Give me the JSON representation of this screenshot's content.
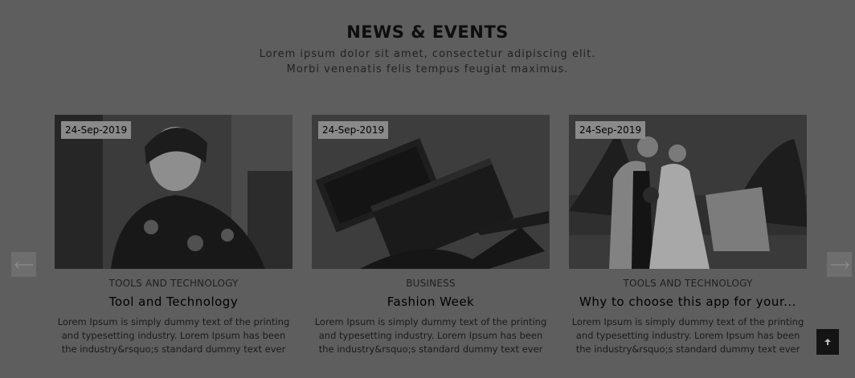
{
  "section": {
    "title": "NEWS & EVENTS",
    "subtitle_line1": "Lorem ipsum dolor sit amet, consectetur adipiscing elit.",
    "subtitle_line2": "Morbi venenatis felis tempus feugiat maximus."
  },
  "cards": [
    {
      "date": "24-Sep-2019",
      "category": "TOOLS AND TECHNOLOGY",
      "title": "Tool and Technology",
      "description": "Lorem Ipsum is simply dummy text of the printing and typesetting industry. Lorem Ipsum has been the industry&rsquo;s standard dummy text ever since..."
    },
    {
      "date": "24-Sep-2019",
      "category": "BUSINESS",
      "title": "Fashion Week",
      "description": "Lorem Ipsum is simply dummy text of the printing and typesetting industry. Lorem Ipsum has been the industry&rsquo;s standard dummy text ever since..."
    },
    {
      "date": "24-Sep-2019",
      "category": "TOOLS AND TECHNOLOGY",
      "title": "Why to choose this app for your...",
      "description": "Lorem Ipsum is simply dummy text of the printing and typesetting industry. Lorem Ipsum has been the industry&rsquo;s standard dummy text ever since..."
    }
  ],
  "controls": {
    "prev_icon": "arrow-left-icon",
    "next_icon": "arrow-right-icon",
    "back_to_top_icon": "arrow-up-icon"
  },
  "colors": {
    "overlay_background": "#5e5e5e",
    "date_badge": "#8a8a8a",
    "back_to_top": "#141414"
  }
}
